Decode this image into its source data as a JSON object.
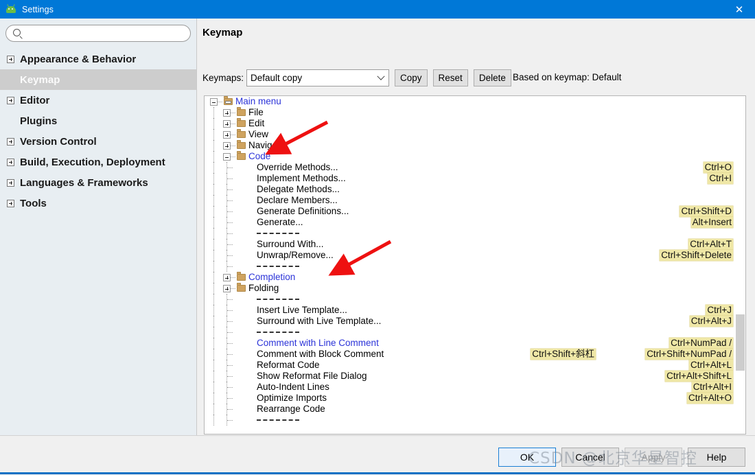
{
  "window": {
    "title": "Settings",
    "icon": "android-studio-icon",
    "close_label": "✕"
  },
  "sidebar": {
    "search_placeholder": "",
    "search_value": "",
    "items": [
      {
        "label": "Appearance & Behavior",
        "expandable": true,
        "selected": false
      },
      {
        "label": "Keymap",
        "expandable": false,
        "selected": true
      },
      {
        "label": "Editor",
        "expandable": true,
        "selected": false
      },
      {
        "label": "Plugins",
        "expandable": false,
        "selected": false
      },
      {
        "label": "Version Control",
        "expandable": true,
        "selected": false
      },
      {
        "label": "Build, Execution, Deployment",
        "expandable": true,
        "selected": false
      },
      {
        "label": "Languages & Frameworks",
        "expandable": true,
        "selected": false
      },
      {
        "label": "Tools",
        "expandable": true,
        "selected": false
      }
    ]
  },
  "panel": {
    "title": "Keymap",
    "keymaps_label": "Keymaps:",
    "keymap_value": "Default copy",
    "buttons": {
      "copy": "Copy",
      "reset": "Reset",
      "delete": "Delete"
    },
    "based_on": "Based on keymap: Default",
    "toolbar": {
      "expand_all": "expand-all-icon",
      "collapse_all": "collapse-all-icon",
      "edit": "edit-pencil-icon"
    },
    "find": {
      "value": "",
      "placeholder": "",
      "clear_label": "⊗"
    }
  },
  "tree": {
    "rows": [
      {
        "type": "node",
        "label": "Main menu",
        "depth": 0,
        "expanded": true,
        "blue": true,
        "icon": "window-folder",
        "shortcut": ""
      },
      {
        "type": "node",
        "label": "File",
        "depth": 1,
        "expanded": false,
        "blue": false,
        "icon": "folder",
        "shortcut": ""
      },
      {
        "type": "node",
        "label": "Edit",
        "depth": 1,
        "expanded": false,
        "blue": false,
        "icon": "folder",
        "shortcut": ""
      },
      {
        "type": "node",
        "label": "View",
        "depth": 1,
        "expanded": false,
        "blue": false,
        "icon": "folder",
        "shortcut": ""
      },
      {
        "type": "node",
        "label": "Navigate",
        "depth": 1,
        "expanded": false,
        "blue": false,
        "icon": "folder",
        "shortcut": ""
      },
      {
        "type": "node",
        "label": "Code",
        "depth": 1,
        "expanded": true,
        "blue": true,
        "icon": "folder",
        "shortcut": ""
      },
      {
        "type": "leaf",
        "label": "Override Methods...",
        "depth": 2,
        "blue": false,
        "shortcut": "Ctrl+O"
      },
      {
        "type": "leaf",
        "label": "Implement Methods...",
        "depth": 2,
        "blue": false,
        "shortcut": "Ctrl+I"
      },
      {
        "type": "leaf",
        "label": "Delegate Methods...",
        "depth": 2,
        "blue": false,
        "shortcut": ""
      },
      {
        "type": "leaf",
        "label": "Declare Members...",
        "depth": 2,
        "blue": false,
        "shortcut": ""
      },
      {
        "type": "leaf",
        "label": "Generate Definitions...",
        "depth": 2,
        "blue": false,
        "shortcut": "Ctrl+Shift+D"
      },
      {
        "type": "leaf",
        "label": "Generate...",
        "depth": 2,
        "blue": false,
        "shortcut": "Alt+Insert"
      },
      {
        "type": "separator",
        "label": "",
        "depth": 2,
        "shortcut": ""
      },
      {
        "type": "leaf",
        "label": "Surround With...",
        "depth": 2,
        "blue": false,
        "shortcut": "Ctrl+Alt+T"
      },
      {
        "type": "leaf",
        "label": "Unwrap/Remove...",
        "depth": 2,
        "blue": false,
        "shortcut": "Ctrl+Shift+Delete"
      },
      {
        "type": "separator",
        "label": "",
        "depth": 2,
        "shortcut": ""
      },
      {
        "type": "node",
        "label": "Completion",
        "depth": 1,
        "expanded": false,
        "blue": true,
        "icon": "folder",
        "shortcut": ""
      },
      {
        "type": "node",
        "label": "Folding",
        "depth": 1,
        "expanded": false,
        "blue": false,
        "icon": "folder",
        "shortcut": ""
      },
      {
        "type": "separator",
        "label": "",
        "depth": 2,
        "shortcut": ""
      },
      {
        "type": "leaf",
        "label": "Insert Live Template...",
        "depth": 2,
        "blue": false,
        "shortcut": "Ctrl+J"
      },
      {
        "type": "leaf",
        "label": "Surround with Live Template...",
        "depth": 2,
        "blue": false,
        "shortcut": "Ctrl+Alt+J"
      },
      {
        "type": "separator",
        "label": "",
        "depth": 2,
        "shortcut": ""
      },
      {
        "type": "leaf",
        "label": "Comment with Line Comment",
        "depth": 2,
        "blue": true,
        "shortcut": "Ctrl+NumPad /"
      },
      {
        "type": "leaf",
        "label": "Comment with Block Comment",
        "depth": 2,
        "blue": false,
        "shortcut": "Ctrl+Shift+NumPad /",
        "shortcut2": "Ctrl+Shift+斜杠"
      },
      {
        "type": "leaf",
        "label": "Reformat Code",
        "depth": 2,
        "blue": false,
        "shortcut": "Ctrl+Alt+L"
      },
      {
        "type": "leaf",
        "label": "Show Reformat File Dialog",
        "depth": 2,
        "blue": false,
        "shortcut": "Ctrl+Alt+Shift+L"
      },
      {
        "type": "leaf",
        "label": "Auto-Indent Lines",
        "depth": 2,
        "blue": false,
        "shortcut": "Ctrl+Alt+I"
      },
      {
        "type": "leaf",
        "label": "Optimize Imports",
        "depth": 2,
        "blue": false,
        "shortcut": "Ctrl+Alt+O"
      },
      {
        "type": "leaf",
        "label": "Rearrange Code",
        "depth": 2,
        "blue": false,
        "shortcut": ""
      },
      {
        "type": "separator",
        "label": "",
        "depth": 2,
        "shortcut": ""
      }
    ]
  },
  "footer": {
    "ok": "OK",
    "cancel": "Cancel",
    "apply": "Apply",
    "help": "Help"
  },
  "watermark": "CSDN @北京华星智控",
  "colors": {
    "titlebar": "#0078d7",
    "selection": "#cdcdcd",
    "link": "#2b33d8",
    "shortcut_highlight": "#efe7a6",
    "annotation_arrow": "#ee1111"
  }
}
